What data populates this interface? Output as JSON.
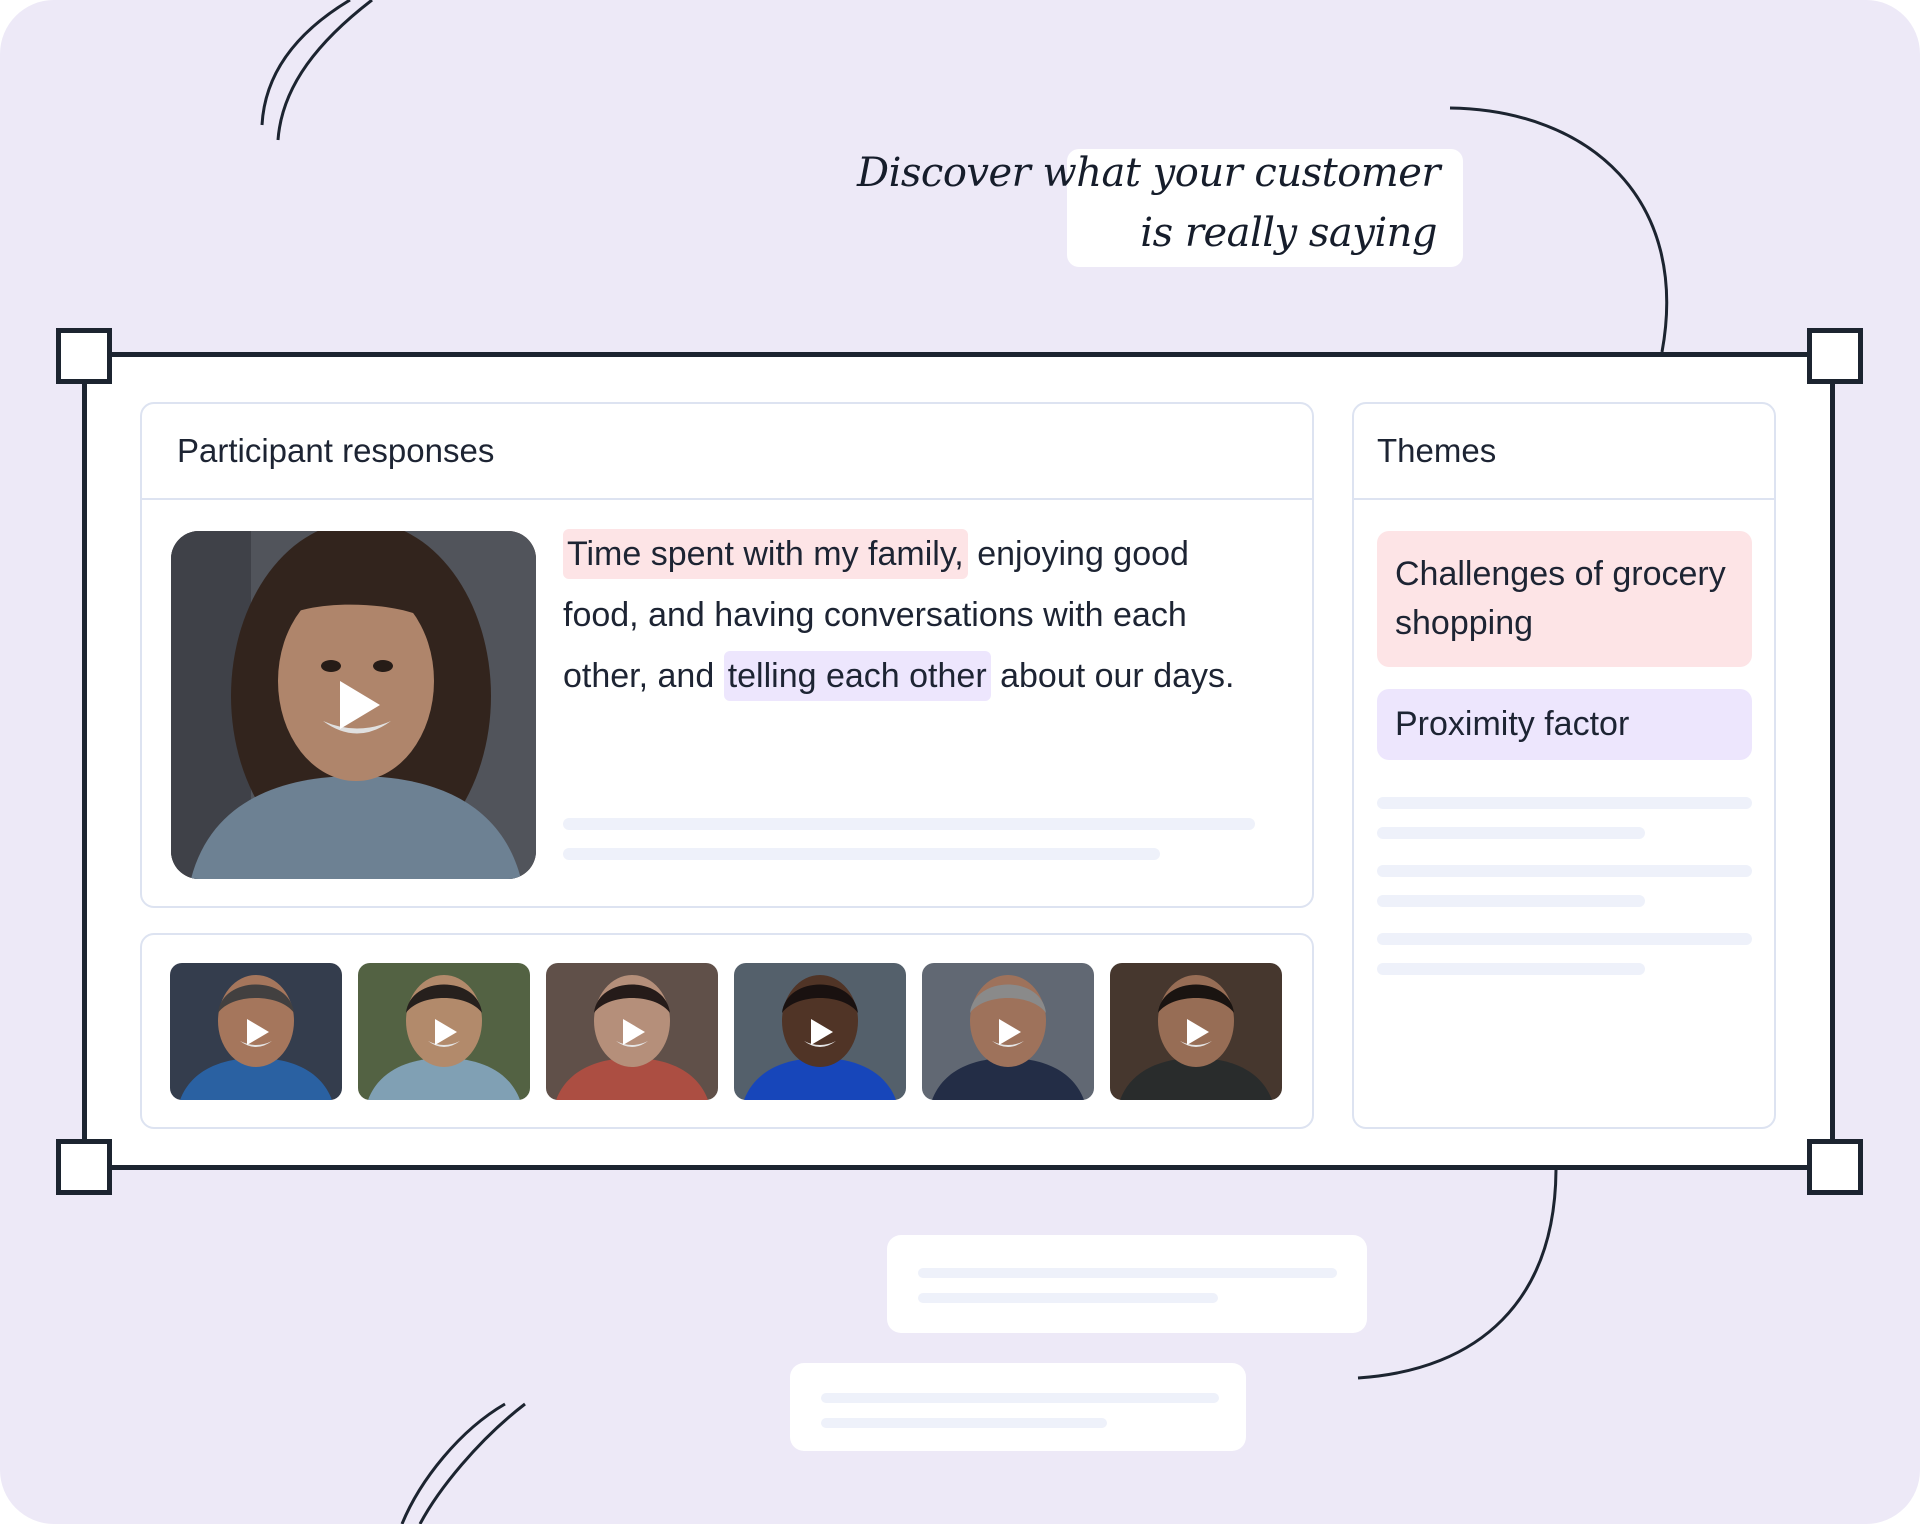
{
  "tagline": {
    "line1": "Discover what your customer",
    "line2": "is really saying"
  },
  "responses": {
    "title": "Participant responses",
    "quote": {
      "highlight1": "Time spent with my family,",
      "part2": " enjoying good food, and having conversations with each other, and ",
      "highlight2": "telling each other",
      "part3": " about our days."
    },
    "participants": [
      {
        "name": "participant-1",
        "shirt": "#2f6db5",
        "skin": "#b88467",
        "hair": "#4a4848",
        "bg": "#3a4456"
      },
      {
        "name": "participant-2",
        "shirt": "#8fb3c9",
        "skin": "#c79a78",
        "hair": "#2b2421",
        "bg": "#5d6e4b"
      },
      {
        "name": "participant-3",
        "shirt": "#c0574a",
        "skin": "#caa088",
        "hair": "#2a1f1c",
        "bg": "#6b5a52"
      },
      {
        "name": "participant-4",
        "shirt": "#1a4fd0",
        "skin": "#5a3a2b",
        "hair": "#1c1412",
        "bg": "#5e6b78"
      },
      {
        "name": "participant-5",
        "shirt": "#27334f",
        "skin": "#b07f66",
        "hair": "#9a9a9a",
        "bg": "#6c7480"
      },
      {
        "name": "participant-6",
        "shirt": "#2e3132",
        "skin": "#a97a5f",
        "hair": "#1e1714",
        "bg": "#4e3e34"
      }
    ]
  },
  "themes": {
    "title": "Themes",
    "items": [
      {
        "label": "Challenges of grocery shopping",
        "color": "#fde4e6"
      },
      {
        "label": "Proximity factor",
        "color": "#ede6fd"
      }
    ]
  },
  "colors": {
    "background": "#ede9f7",
    "frame": "#1c2430",
    "highlight_pink": "#fde4e6",
    "highlight_lavender": "#ede6fd",
    "skeleton": "#eef1fa"
  }
}
